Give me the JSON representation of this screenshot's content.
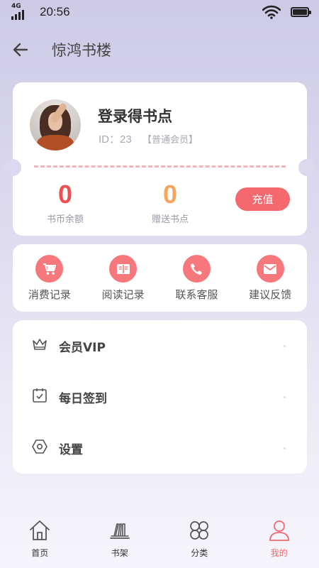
{
  "status_bar": {
    "network": "4G",
    "time": "20:56"
  },
  "nav": {
    "title": "惊鸿书楼"
  },
  "profile": {
    "login_prompt": "登录得书点",
    "id_label": "ID：23",
    "member_level": "【普通会员】",
    "coin_balance": "0",
    "coin_label": "书币余额",
    "gift_points": "0",
    "gift_label": "赠送书点",
    "recharge_label": "充值"
  },
  "quick_actions": [
    {
      "label": "消费记录",
      "icon": "cart-icon"
    },
    {
      "label": "阅读记录",
      "icon": "book-open-icon"
    },
    {
      "label": "联系客服",
      "icon": "phone-icon"
    },
    {
      "label": "建议反馈",
      "icon": "mail-icon"
    }
  ],
  "menu": [
    {
      "label": "会员VIP",
      "icon": "crown-icon"
    },
    {
      "label": "每日签到",
      "icon": "calendar-check-icon"
    },
    {
      "label": "设置",
      "icon": "hexagon-settings-icon"
    }
  ],
  "tabs": [
    {
      "label": "首页",
      "icon": "home-icon",
      "active": false
    },
    {
      "label": "书架",
      "icon": "bookshelf-icon",
      "active": false
    },
    {
      "label": "分类",
      "icon": "category-icon",
      "active": false
    },
    {
      "label": "我的",
      "icon": "user-icon",
      "active": true
    }
  ],
  "colors": {
    "accent": "#f5686d",
    "coin": "#ee4f52",
    "gift": "#f5a65b",
    "active_tab": "#ee6a6e"
  }
}
